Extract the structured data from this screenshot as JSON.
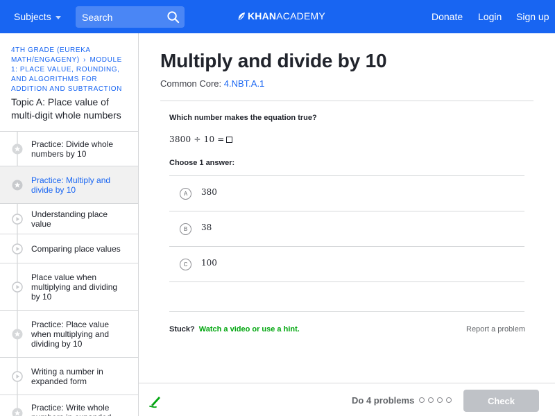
{
  "topnav": {
    "subjects_label": "Subjects",
    "search_placeholder": "Search",
    "logo_brand": "KHAN",
    "logo_suffix": "ACADEMY",
    "donate_label": "Donate",
    "login_label": "Login",
    "signup_label": "Sign up",
    "bar_color": "#1865f2"
  },
  "sidebar": {
    "breadcrumb_course": "4th grade (Eureka Math/EngageNY)",
    "breadcrumb_separator": "›",
    "breadcrumb_module": "Module 1: Place value, rounding, and algorithms for addition and subtraction",
    "topic_title": "Topic A: Place value of multi-digit whole numbers",
    "items": [
      {
        "label": "Practice: Divide whole numbers by 10",
        "icon": "star-icon",
        "active": false
      },
      {
        "label": "Practice: Multiply and divide by 10",
        "icon": "star-icon",
        "active": true
      },
      {
        "label": "Understanding place value",
        "icon": "play-icon",
        "active": false
      },
      {
        "label": "Comparing place values",
        "icon": "play-icon",
        "active": false
      },
      {
        "label": "Place value when multiplying and dividing by 10",
        "icon": "play-icon",
        "active": false
      },
      {
        "label": "Practice: Place value when multiplying and dividing by 10",
        "icon": "star-icon",
        "active": false
      },
      {
        "label": "Writing a number in expanded form",
        "icon": "play-icon",
        "active": false
      },
      {
        "label": "Practice: Write whole numbers in expanded form",
        "icon": "star-icon",
        "active": false
      }
    ]
  },
  "main": {
    "title": "Multiply and divide by 10",
    "common_core_label": "Common Core:",
    "common_core_code": "4.NBT.A.1",
    "question_prompt": "Which number makes the equation true?",
    "equation": "3800 ÷ 10 =",
    "choose_label": "Choose 1 answer:",
    "choices": [
      {
        "letter": "A",
        "value": "380"
      },
      {
        "letter": "B",
        "value": "38"
      },
      {
        "letter": "C",
        "value": "100"
      }
    ],
    "stuck_label": "Stuck?",
    "stuck_link": "Watch a video or use a hint.",
    "report_label": "Report a problem"
  },
  "footer": {
    "do_problems_label": "Do 4 problems",
    "problem_count": 4,
    "completed": 0,
    "check_label": "Check",
    "scratchpad_icon": "pencil-icon"
  }
}
